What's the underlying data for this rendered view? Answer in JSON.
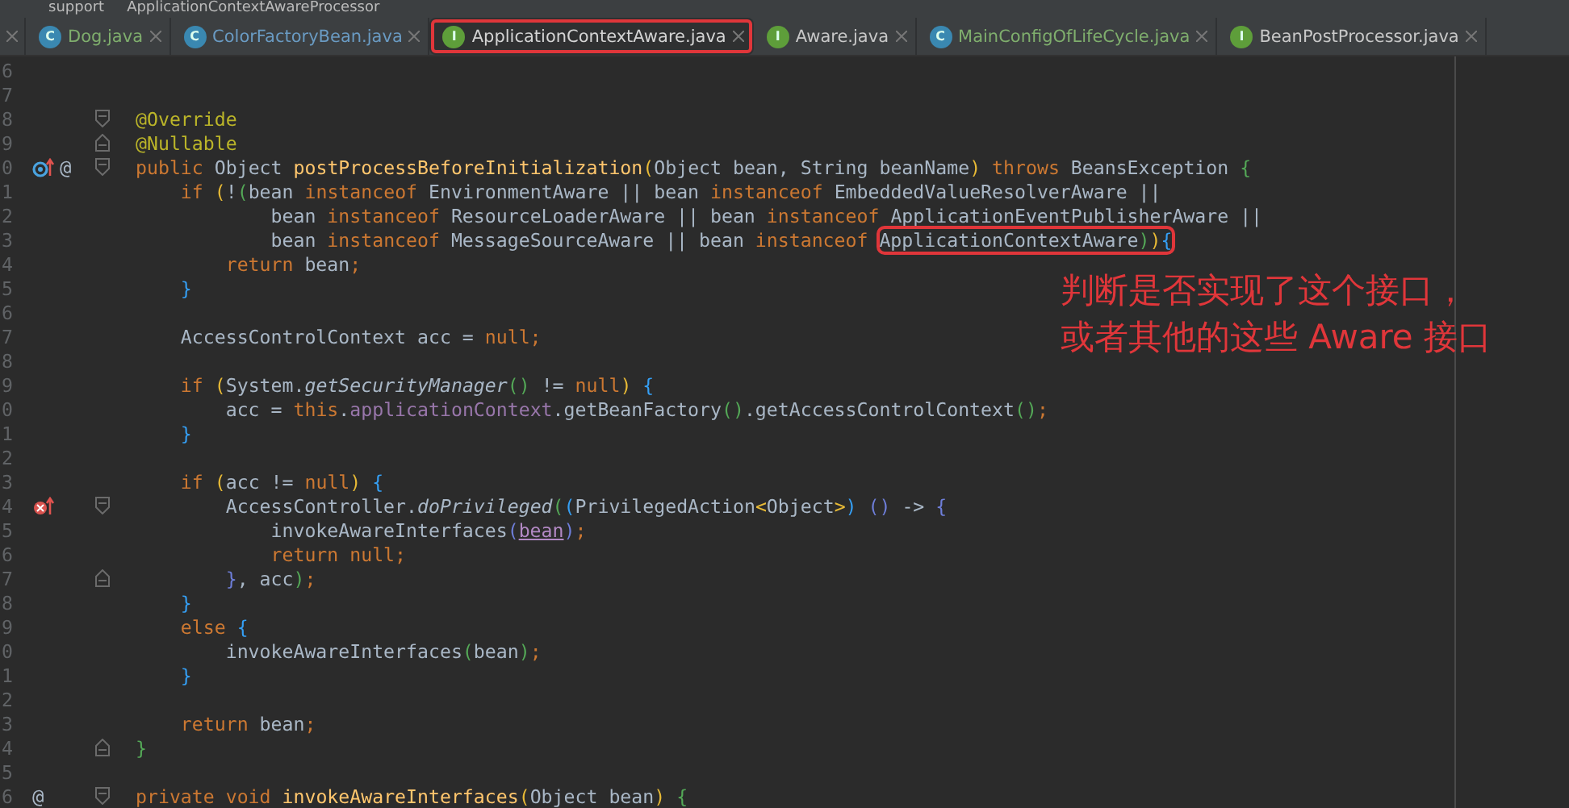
{
  "breadcrumb": [
    "support",
    "ApplicationContextAwareProcessor"
  ],
  "tabs": [
    {
      "label": "Dog.java",
      "icon": {
        "kind": "class",
        "letter": "C"
      },
      "color": "#7fae6d",
      "selected": false,
      "highlighted": false
    },
    {
      "label": "ColorFactoryBean.java",
      "icon": {
        "kind": "class",
        "letter": "C"
      },
      "color": "#6a9bc3",
      "selected": false,
      "highlighted": false
    },
    {
      "label": "ApplicationContextAware.java",
      "icon": {
        "kind": "interface",
        "letter": "I"
      },
      "color": "#d4d4d4",
      "selected": true,
      "highlighted": true
    },
    {
      "label": "Aware.java",
      "icon": {
        "kind": "interface",
        "letter": "I"
      },
      "color": "#c8c8c8",
      "selected": false,
      "highlighted": false
    },
    {
      "label": "MainConfigOfLifeCycle.java",
      "icon": {
        "kind": "class",
        "letter": "C"
      },
      "color": "#7fae6d",
      "selected": false,
      "highlighted": false
    },
    {
      "label": "BeanPostProcessor.java",
      "icon": {
        "kind": "interface",
        "letter": "I"
      },
      "color": "#c8c8c8",
      "selected": false,
      "highlighted": false
    }
  ],
  "lines": [
    {
      "number": "6"
    },
    {
      "number": "7"
    },
    {
      "number": "8",
      "fold_start": true,
      "tokens": [
        {
          "kind": "annotation",
          "text": "@Override"
        }
      ]
    },
    {
      "number": "9",
      "fold_end": true,
      "tokens": [
        {
          "kind": "annotation",
          "text": "@Nullable"
        }
      ]
    },
    {
      "number": "0",
      "fold_start": true,
      "gutter": [
        {
          "kind": "implements"
        },
        {
          "kind": "text",
          "text": "@"
        }
      ],
      "tokens": [
        {
          "kind": "keyword",
          "text": "public "
        },
        {
          "kind": "plain",
          "text": "Object "
        },
        {
          "kind": "method",
          "text": "postProcessBeforeInitialization"
        },
        {
          "kind": "yellow",
          "text": "("
        },
        {
          "kind": "plain",
          "text": "Object bean, String beanName"
        },
        {
          "kind": "yellow",
          "text": ")"
        },
        {
          "kind": "keyword",
          "text": " throws "
        },
        {
          "kind": "plain",
          "text": "BeansException "
        },
        {
          "kind": "green",
          "text": "{"
        }
      ]
    },
    {
      "number": "1",
      "tokens": [
        {
          "kind": "keyword",
          "text": "    if "
        },
        {
          "kind": "yellow",
          "text": "("
        },
        {
          "kind": "plain",
          "text": "!"
        },
        {
          "kind": "green",
          "text": "("
        },
        {
          "kind": "plain",
          "text": "bean "
        },
        {
          "kind": "keyword",
          "text": "instanceof "
        },
        {
          "kind": "plain",
          "text": "EnvironmentAware || bean "
        },
        {
          "kind": "keyword",
          "text": "instanceof "
        },
        {
          "kind": "plain",
          "text": "EmbeddedValueResolverAware ||"
        }
      ]
    },
    {
      "number": "2",
      "tokens": [
        {
          "kind": "plain",
          "text": "            bean "
        },
        {
          "kind": "keyword",
          "text": "instanceof "
        },
        {
          "kind": "plain",
          "text": "ResourceLoaderAware || bean "
        },
        {
          "kind": "keyword",
          "text": "instanceof "
        },
        {
          "kind": "plain",
          "text": "ApplicationEventPublisherAware ||"
        }
      ]
    },
    {
      "number": "3",
      "tokens": [
        {
          "kind": "plain",
          "text": "            bean "
        },
        {
          "kind": "keyword",
          "text": "instanceof "
        },
        {
          "kind": "plain",
          "text": "MessageSourceAware || bean "
        },
        {
          "kind": "keyword",
          "text": "instanceof "
        },
        {
          "kind": "plain",
          "text": "ApplicationContextAware",
          "boxed": true
        },
        {
          "kind": "green",
          "text": ")",
          "boxed": true
        },
        {
          "kind": "yellow",
          "text": ")",
          "boxed": true
        },
        {
          "kind": "blue",
          "text": "{",
          "boxed": true
        }
      ]
    },
    {
      "number": "4",
      "tokens": [
        {
          "kind": "keyword",
          "text": "        return "
        },
        {
          "kind": "plain",
          "text": "bean"
        },
        {
          "kind": "keyword",
          "text": ";"
        }
      ]
    },
    {
      "number": "5",
      "tokens": [
        {
          "kind": "blue",
          "text": "    }"
        }
      ]
    },
    {
      "number": "6"
    },
    {
      "number": "7",
      "tokens": [
        {
          "kind": "plain",
          "text": "    AccessControlContext acc = "
        },
        {
          "kind": "keyword",
          "text": "null;"
        }
      ]
    },
    {
      "number": "8"
    },
    {
      "number": "9",
      "tokens": [
        {
          "kind": "keyword",
          "text": "    if "
        },
        {
          "kind": "yellow",
          "text": "("
        },
        {
          "kind": "plain",
          "text": "System."
        },
        {
          "kind": "static",
          "text": "getSecurityManager"
        },
        {
          "kind": "green",
          "text": "()"
        },
        {
          "kind": "plain",
          "text": " != "
        },
        {
          "kind": "keyword",
          "text": "null"
        },
        {
          "kind": "yellow",
          "text": ")"
        },
        {
          "kind": "blue",
          "text": " {"
        }
      ]
    },
    {
      "number": "0",
      "tokens": [
        {
          "kind": "plain",
          "text": "        acc = "
        },
        {
          "kind": "keyword",
          "text": "this"
        },
        {
          "kind": "plain",
          "text": "."
        },
        {
          "kind": "field",
          "text": "applicationContext"
        },
        {
          "kind": "plain",
          "text": ".getBeanFactory"
        },
        {
          "kind": "green",
          "text": "()"
        },
        {
          "kind": "plain",
          "text": ".getAccessControlContext"
        },
        {
          "kind": "green",
          "text": "()"
        },
        {
          "kind": "keyword",
          "text": ";"
        }
      ]
    },
    {
      "number": "1",
      "tokens": [
        {
          "kind": "blue",
          "text": "    }"
        }
      ]
    },
    {
      "number": "2"
    },
    {
      "number": "3",
      "tokens": [
        {
          "kind": "keyword",
          "text": "    if "
        },
        {
          "kind": "yellow",
          "text": "("
        },
        {
          "kind": "plain",
          "text": "acc != "
        },
        {
          "kind": "keyword",
          "text": "null"
        },
        {
          "kind": "yellow",
          "text": ")"
        },
        {
          "kind": "blue",
          "text": " {"
        }
      ]
    },
    {
      "number": "4",
      "fold_start": true,
      "gutter": [
        {
          "kind": "lambda"
        }
      ],
      "tokens": [
        {
          "kind": "plain",
          "text": "        AccessController."
        },
        {
          "kind": "static",
          "text": "doPrivileged"
        },
        {
          "kind": "green",
          "text": "("
        },
        {
          "kind": "blue",
          "text": "("
        },
        {
          "kind": "plain",
          "text": "PrivilegedAction"
        },
        {
          "kind": "yellow",
          "text": "<"
        },
        {
          "kind": "plain",
          "text": "Object"
        },
        {
          "kind": "yellow",
          "text": ">"
        },
        {
          "kind": "blue",
          "text": ")"
        },
        {
          "kind": "violet",
          "text": " () "
        },
        {
          "kind": "plain",
          "text": "-> "
        },
        {
          "kind": "violet",
          "text": "{"
        }
      ]
    },
    {
      "number": "5",
      "tokens": [
        {
          "kind": "plain",
          "text": "            invokeAwareInterfaces"
        },
        {
          "kind": "violet",
          "text": "("
        },
        {
          "kind": "parameter",
          "text": "bean"
        },
        {
          "kind": "violet",
          "text": ")"
        },
        {
          "kind": "keyword",
          "text": ";"
        }
      ]
    },
    {
      "number": "6",
      "tokens": [
        {
          "kind": "keyword",
          "text": "            return null;"
        }
      ]
    },
    {
      "number": "7",
      "fold_end": true,
      "tokens": [
        {
          "kind": "violet",
          "text": "        }"
        },
        {
          "kind": "plain",
          "text": ", acc"
        },
        {
          "kind": "green",
          "text": ")"
        },
        {
          "kind": "keyword",
          "text": ";"
        }
      ]
    },
    {
      "number": "8",
      "tokens": [
        {
          "kind": "blue",
          "text": "    }"
        }
      ]
    },
    {
      "number": "9",
      "tokens": [
        {
          "kind": "keyword",
          "text": "    else "
        },
        {
          "kind": "blue",
          "text": "{"
        }
      ]
    },
    {
      "number": "0",
      "tokens": [
        {
          "kind": "plain",
          "text": "        invokeAwareInterfaces"
        },
        {
          "kind": "green",
          "text": "("
        },
        {
          "kind": "plain",
          "text": "bean"
        },
        {
          "kind": "green",
          "text": ")"
        },
        {
          "kind": "keyword",
          "text": ";"
        }
      ]
    },
    {
      "number": "1",
      "tokens": [
        {
          "kind": "blue",
          "text": "    }"
        }
      ]
    },
    {
      "number": "2"
    },
    {
      "number": "3",
      "tokens": [
        {
          "kind": "keyword",
          "text": "    return "
        },
        {
          "kind": "plain",
          "text": "bean"
        },
        {
          "kind": "keyword",
          "text": ";"
        }
      ]
    },
    {
      "number": "4",
      "fold_end": true,
      "tokens": [
        {
          "kind": "green",
          "text": "}"
        }
      ]
    },
    {
      "number": "5"
    },
    {
      "number": "6",
      "fold_start": true,
      "gutter": [
        {
          "kind": "text",
          "text": "@"
        }
      ],
      "tokens": [
        {
          "kind": "keyword",
          "text": "private void "
        },
        {
          "kind": "method",
          "text": "invokeAwareInterfaces"
        },
        {
          "kind": "yellow",
          "text": "("
        },
        {
          "kind": "plain",
          "text": "Object bean"
        },
        {
          "kind": "yellow",
          "text": ")"
        },
        {
          "kind": "green",
          "text": " {"
        }
      ]
    }
  ],
  "note": [
    "判断是否实现了这个接口，",
    "或者其他的这些 Aware 接口"
  ]
}
